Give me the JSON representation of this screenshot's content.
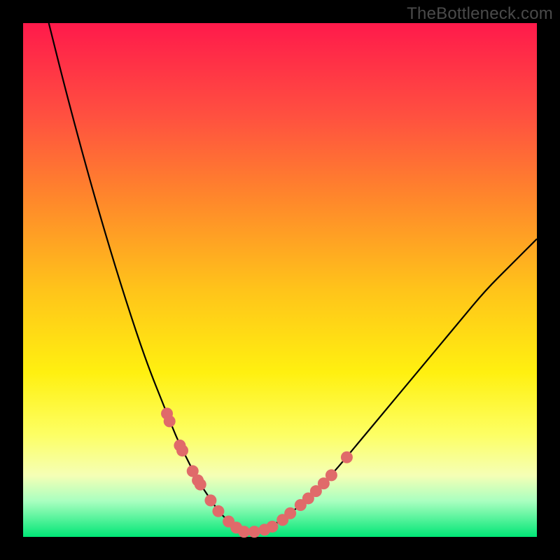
{
  "watermark": "TheBottleneck.com",
  "palette": {
    "curve": "#000000",
    "dot_fill": "#e06a6a",
    "dot_stroke": "#c94f4f",
    "bg_black": "#000000"
  },
  "chart_data": {
    "type": "line",
    "title": "",
    "xlabel": "",
    "ylabel": "",
    "xlim": [
      0,
      100
    ],
    "ylim": [
      0,
      100
    ],
    "series": [
      {
        "name": "bottleneck-curve",
        "x": [
          5,
          8,
          12,
          16,
          20,
          24,
          28,
          30,
          32,
          34,
          36,
          38,
          40,
          42,
          43.5,
          45,
          47,
          50,
          55,
          60,
          65,
          70,
          75,
          80,
          85,
          90,
          95,
          100
        ],
        "y": [
          100,
          88,
          73,
          59,
          46,
          34,
          24,
          19,
          15,
          11,
          8,
          5,
          3,
          1.5,
          1,
          1,
          1.5,
          3,
          7,
          12,
          18,
          24,
          30,
          36,
          42,
          48,
          53,
          58
        ]
      }
    ],
    "markers": {
      "name": "sample-points",
      "x_left": [
        28.0,
        28.5,
        30.5,
        31.0,
        33.0,
        34.0,
        34.5,
        36.5,
        38.0,
        40.0,
        41.5
      ],
      "y_left": [
        24.0,
        22.5,
        17.8,
        16.8,
        12.8,
        11.0,
        10.2,
        7.1,
        5.0,
        3.0,
        1.8
      ],
      "x_bottom": [
        43.0,
        45.0,
        47.0,
        48.5
      ],
      "y_bottom": [
        1.0,
        1.0,
        1.4,
        2.0
      ],
      "x_right": [
        50.5,
        52.0,
        54.0,
        55.5,
        57.0,
        58.5,
        60.0,
        63.0
      ],
      "y_right": [
        3.3,
        4.6,
        6.2,
        7.5,
        8.9,
        10.4,
        12.0,
        15.5
      ]
    }
  }
}
